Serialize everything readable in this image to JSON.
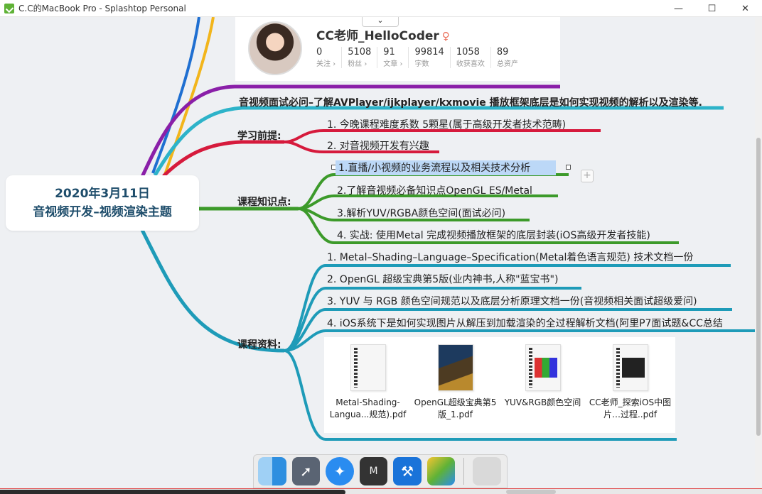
{
  "window": {
    "title": "C.C的MacBook Pro - Splashtop Personal",
    "minimize": "—",
    "maximize": "☐",
    "close": "✕"
  },
  "profile": {
    "name": "CC老师_HelloCoder",
    "gender_icon": "♀",
    "collapse": "⌄",
    "stats": [
      {
        "num": "0",
        "label": "关注 ›"
      },
      {
        "num": "5108",
        "label": "粉丝 ›"
      },
      {
        "num": "91",
        "label": "文章 ›"
      },
      {
        "num": "99814",
        "label": "字数"
      },
      {
        "num": "1058",
        "label": "收获喜欢"
      },
      {
        "num": "89",
        "label": "总资产"
      }
    ]
  },
  "central": {
    "line1": "2020年3月11日",
    "line2": "音视频开发–视频渲染主题"
  },
  "topic_main": "音视频面试必问–了解AVPlayer/ijkplayer/kxmovie 播放框架底层是如何实现视频的解析以及渲染等.",
  "prereq": {
    "label": "学习前提:",
    "items": [
      "1. 今晚课程难度系数 5颗星(属于高级开发者技术范畴)",
      "2. 对音视频开发有兴趣"
    ]
  },
  "knowledge": {
    "label": "课程知识点:",
    "items": [
      "1.直播/小视频的业务流程以及相关技术分析",
      "2.了解音视频必备知识点OpenGL ES/Metal",
      "3.解析YUV/RGBA颜色空间(面试必问)",
      "4. 实战: 使用Metal 完成视频播放框架的底层封装(iOS高级开发者技能)"
    ],
    "add_button": "+"
  },
  "resources": {
    "label": "课程资料:",
    "items": [
      "1. Metal–Shading–Language–Specification(Metal着色语言规范) 技术文档一份",
      "2. OpenGL 超级宝典第5版(业内神书,人称\"蓝宝书\")",
      "3. YUV 与 RGB 颜色空间规范以及底层分析原理文档一份(音视频相关面试超级爱问)",
      "4. iOS系统下是如何实现图片从解压到加载渲染的全过程解析文档(阿里P7面试题&CC总结"
    ],
    "files": [
      {
        "name": "Metal-Shading-Langua...规范).pdf"
      },
      {
        "name": "OpenGL超级宝典第5版_1.pdf"
      },
      {
        "name": "YUV&RGB颜色空间"
      },
      {
        "name": "CC老师_探索iOS中图片…过程..pdf"
      }
    ]
  },
  "dock": {
    "icons": [
      "finder-icon",
      "launchpad-icon",
      "safari-icon",
      "code-editor-icon",
      "xcode-icon",
      "mindnode-icon",
      "trash-icon"
    ]
  },
  "colors": {
    "purple": "#8a1fa8",
    "cyan": "#2db3c9",
    "red": "#d61a3c",
    "green": "#3c9a2a",
    "teal": "#1e9bb8",
    "blue": "#1f6fd1",
    "yellow": "#f2b51b"
  }
}
